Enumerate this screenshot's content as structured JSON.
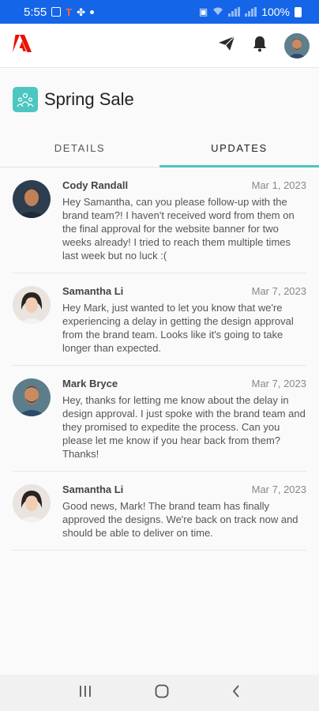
{
  "status_bar": {
    "time": "5:55",
    "battery": "100%"
  },
  "header": {
    "logo_icon": "adobe-logo",
    "actions": [
      "send-icon",
      "bell-icon",
      "avatar"
    ]
  },
  "project": {
    "title": "Spring Sale",
    "icon": "people-icon"
  },
  "tabs": [
    {
      "label": "DETAILS"
    },
    {
      "label": "UPDATES"
    }
  ],
  "active_tab": "UPDATES",
  "accent_color": "#4cc6c0",
  "messages": [
    {
      "author": "Cody Randall",
      "date": "Mar 1, 2023",
      "text": "Hey Samantha, can you please follow-up with the brand team?! I haven't received word from them on the final approval for the website banner for two weeks already! I tried to reach them multiple times last week but no luck :("
    },
    {
      "author": "Samantha Li",
      "date": "Mar 7, 2023",
      "text": "Hey Mark, just wanted to let you know that we're experiencing a delay in getting the design approval from the brand team. Looks like it's going to take longer than expected."
    },
    {
      "author": "Mark Bryce",
      "date": "Mar 7, 2023",
      "text": "Hey, thanks for letting me know about the delay in design approval. I just spoke with the brand team and they promised to expedite the process. Can you please let me know if you hear back from them? Thanks!"
    },
    {
      "author": "Samantha Li",
      "date": "Mar 7, 2023",
      "text": "Good news, Mark! The brand team has finally approved the designs. We're back on track now and should be able to deliver on time."
    }
  ],
  "nav": [
    "recents-icon",
    "home-icon",
    "back-icon"
  ]
}
